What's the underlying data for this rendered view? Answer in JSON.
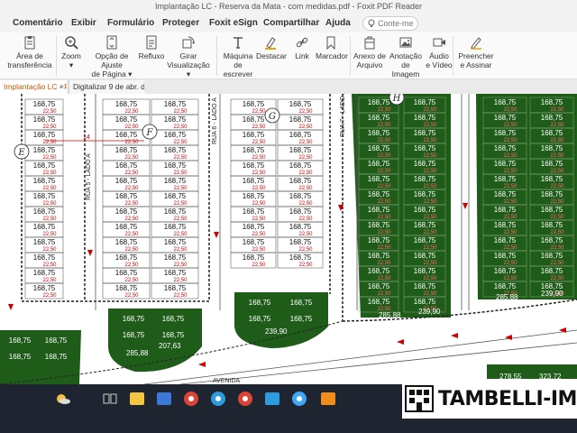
{
  "window": {
    "title": "Implantação LC - Reserva da Mata - com medidas.pdf - Foxit PDF Reader"
  },
  "menu": [
    "Comentário",
    "Exibir",
    "Formulário",
    "Proteger",
    "Foxit eSign",
    "Compartilhar",
    "Ajuda"
  ],
  "search": {
    "placeholder": "Conte-me"
  },
  "ribbon": {
    "tools": [
      {
        "label": "Área de\ntransferência",
        "icon": "clipboard-icon"
      },
      {
        "label": "Zoom\n▾",
        "icon": "zoom-icon"
      },
      {
        "label": "Opção de Ajuste\nde Página ▾",
        "icon": "fit-page-icon"
      },
      {
        "label": "Refluxo",
        "icon": "reflow-icon"
      },
      {
        "label": "Girar\nVisualização ▾",
        "icon": "rotate-icon"
      },
      {
        "label": "Máquina\nde escrever",
        "icon": "typewriter-icon"
      },
      {
        "label": "Destacar",
        "icon": "highlight-icon"
      },
      {
        "label": "Link",
        "icon": "link-icon"
      },
      {
        "label": "Marcador",
        "icon": "bookmark-icon"
      },
      {
        "label": "Anexo de\nArquivo",
        "icon": "attachment-icon"
      },
      {
        "label": "Anotação\nde Imagem",
        "icon": "image-annotation-icon"
      },
      {
        "label": "Áudio\ne Vídeo",
        "icon": "video-icon"
      },
      {
        "label": "Preencher\ne Assinar",
        "icon": "sign-icon"
      }
    ]
  },
  "tabs": [
    {
      "label": "Implantação LC - Rese...",
      "active": true
    },
    {
      "label": "Digitalizar 9 de abr. d...",
      "active": false
    }
  ],
  "plan": {
    "lot_area": "168,75",
    "front": "22,50",
    "corner_lot_area": "285,88",
    "alt_area_1": "239,90",
    "alt_area_2": "207,63",
    "alt_area_3": "278,55",
    "alt_area_4": "323,72",
    "street_labels": [
      "RUA 5 - LADO A",
      "RUA 6 - LADO A",
      "RUA 7 - LADO A"
    ],
    "block_letters": [
      "E",
      "F",
      "G",
      "H"
    ],
    "segment_label": "14",
    "bottom_street": "AVENIDA"
  },
  "watermark": {
    "text": "TAMBELLI-IM"
  },
  "taskbar": {
    "icons": [
      "weather-icon",
      "task-view-icon",
      "file-explorer-icon",
      "calculator-icon",
      "chrome-icon",
      "edge-icon",
      "chrome-icon",
      "music-icon",
      "photos-icon",
      "foxit-icon"
    ]
  },
  "colors": {
    "green_lot": "#1f5c1a",
    "accent": "#d35400",
    "measure_red": "#cc0000"
  }
}
